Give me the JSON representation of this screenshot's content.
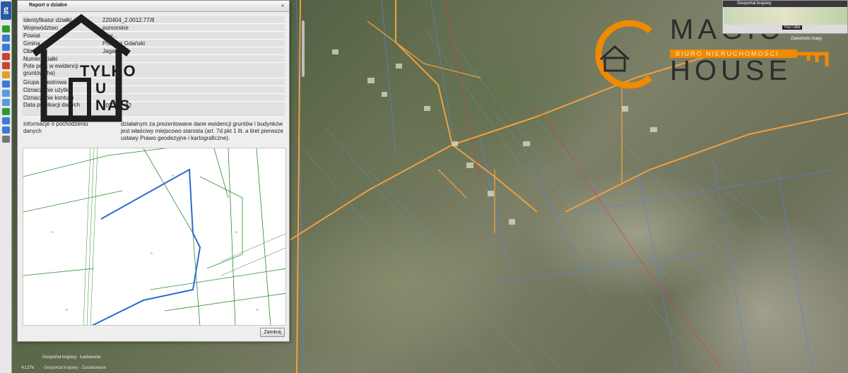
{
  "dialog": {
    "title": "Raport o działce",
    "close_label": "Zamknij",
    "rows": [
      {
        "key": "Identyfikator działki",
        "value": "220404_2.0012.77/8"
      },
      {
        "key": "Województwo",
        "value": "pomorskie"
      },
      {
        "key": "Powiat",
        "value": "pow..."
      },
      {
        "key": "Gmina",
        "value": "Pruszcz Gdański"
      },
      {
        "key": "Obręb",
        "value": "Jagatowo"
      },
      {
        "key": "Numer działki",
        "value": ""
      },
      {
        "key": "Pole pow. w ewidencji gruntów (ha)",
        "value": ""
      },
      {
        "key": "Grupa rejestrowa",
        "value": ""
      },
      {
        "key": "Oznaczenie użytku",
        "value": ""
      },
      {
        "key": "Oznaczenie konturu",
        "value": ""
      },
      {
        "key": "Data publikacji danych",
        "value": "2022-12-22"
      }
    ],
    "info_key": "Informacje o pochodzeniu danych",
    "info_value": "działalnym za prezentowane dane ewidencji gruntów i budynków jest właściwy miejscowo starosta (art. 7d pkt 1 lit. a tiret pierwsze ustawy Prawo geodezyjne i kartograficzne)."
  },
  "badge": {
    "line1": "TYLKO",
    "line2": "U NAS"
  },
  "brand": {
    "magic": "MAGIC",
    "subtitle": "BIURO NIERUCHOMOŚCI",
    "house": "HOUSE",
    "accent": "#f08a00"
  },
  "widget": {
    "title": "Geoportal krajowy",
    "youtube": "YouTube",
    "zoom_label": "Zawartość mapy"
  },
  "status": {
    "line1": "Geoportal krajowy · Ładowanie",
    "coords": "4.127e",
    "line3": "Geoportal krajowy · Zasadowane"
  },
  "toolbar": {
    "logo": "g"
  }
}
